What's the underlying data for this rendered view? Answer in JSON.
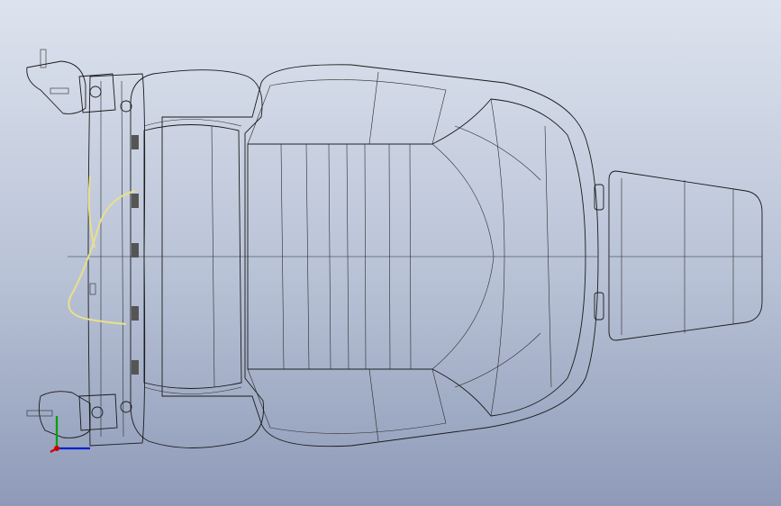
{
  "app": {
    "view": "cad-3d-viewport"
  },
  "model": {
    "parts": [
      "seat-back-frame",
      "seat-back-cushion",
      "seat-bottom-cushion",
      "headrest",
      "recliner-mechanism-top",
      "recliner-mechanism-bottom",
      "wire-harness"
    ]
  },
  "colors": {
    "viewport_top": "#dde3ee",
    "viewport_bottom": "#8e9ab8",
    "cushion_fill": "#ffffff",
    "cushion_shade": "#b9b6e6",
    "mechanism": "#c02cc8",
    "harness": "#e8e08a",
    "axis_x": "#d00000",
    "axis_y": "#00a000",
    "axis_z": "#0020d0"
  },
  "icons": {
    "triad": "coordinate-triad-icon"
  }
}
